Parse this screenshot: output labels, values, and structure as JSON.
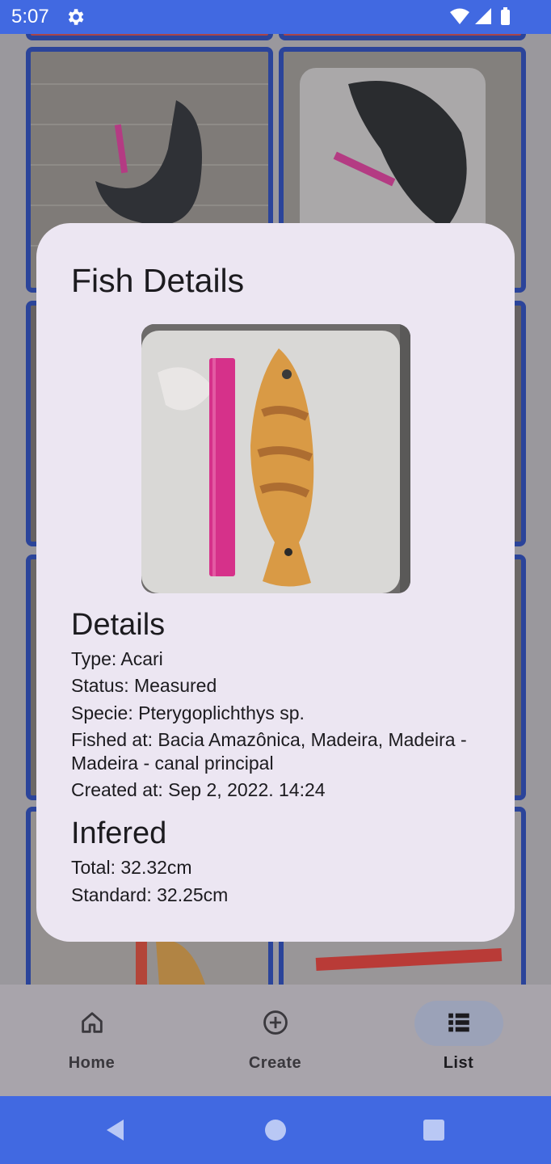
{
  "status_bar": {
    "time": "5:07",
    "icons": [
      "settings-gear-icon",
      "wifi-icon",
      "cell-signal-icon",
      "battery-icon"
    ]
  },
  "dialog": {
    "title": "Fish Details",
    "photo_icon": "fish-photo",
    "details": {
      "heading": "Details",
      "type": "Type: Acari",
      "status": "Status: Measured",
      "specie": "Specie: Pterygoplichthys sp.",
      "fished_at": "Fished at: Bacia Amazônica, Madeira, Madeira - Madeira - canal principal",
      "created_at": "Created at: Sep 2, 2022. 14:24"
    },
    "infered": {
      "heading": "Infered",
      "total": "Total: 32.32cm",
      "standard": "Standard: 32.25cm"
    }
  },
  "bottom_nav": {
    "items": [
      {
        "label": "Home",
        "icon": "home-icon",
        "active": false
      },
      {
        "label": "Create",
        "icon": "add-circle-icon",
        "active": false
      },
      {
        "label": "List",
        "icon": "list-icon",
        "active": true
      }
    ]
  },
  "system_nav": {
    "icons": [
      "back-icon",
      "home-circle-icon",
      "recents-icon"
    ]
  },
  "colors": {
    "status_bar": "#4169e1",
    "card_border": "#2f4aa8",
    "dialog_bg": "#ece6f2",
    "active_pill": "#9ba2b8"
  }
}
